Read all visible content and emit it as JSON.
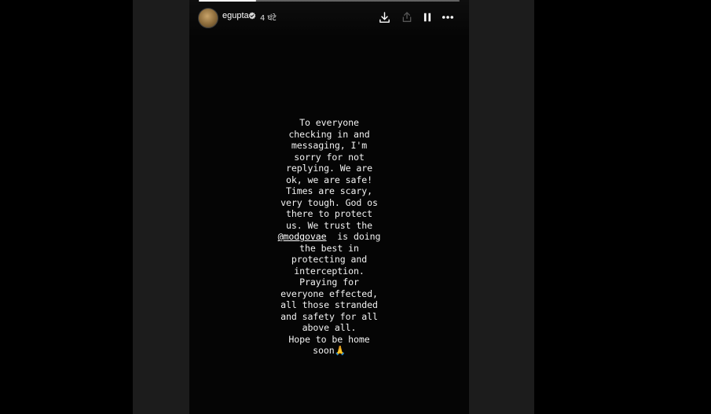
{
  "story": {
    "progress": 0.22,
    "user": {
      "username": "egupta",
      "verified": true,
      "time_ago": "4 घंटे"
    },
    "controls": {
      "download_icon": "download-icon",
      "share_icon": "share-icon",
      "pause_icon": "pause-icon",
      "more_icon": "more-options-icon"
    },
    "text_lines": [
      "To everyone",
      "checking in and",
      "messaging, I'm",
      "sorry for not",
      "replying. We are",
      "ok, we are safe!",
      "Times are scary,",
      "very tough. God os",
      "there to protect",
      "us. We trust the"
    ],
    "mention": "@modgovae",
    "mention_suffix": "  is doing",
    "text_lines_after": [
      "the best in",
      "protecting and",
      "interception.",
      "Praying for",
      "everyone effected,",
      "all those stranded",
      "and safety for all",
      "above all.",
      "Hope to be home"
    ],
    "last_line": "soon",
    "last_emoji": "🙏"
  },
  "colors": {
    "background": "#000000",
    "side_panels": "#1c1c1c",
    "story_bg": "#050505",
    "text": "#f2f2f2"
  }
}
